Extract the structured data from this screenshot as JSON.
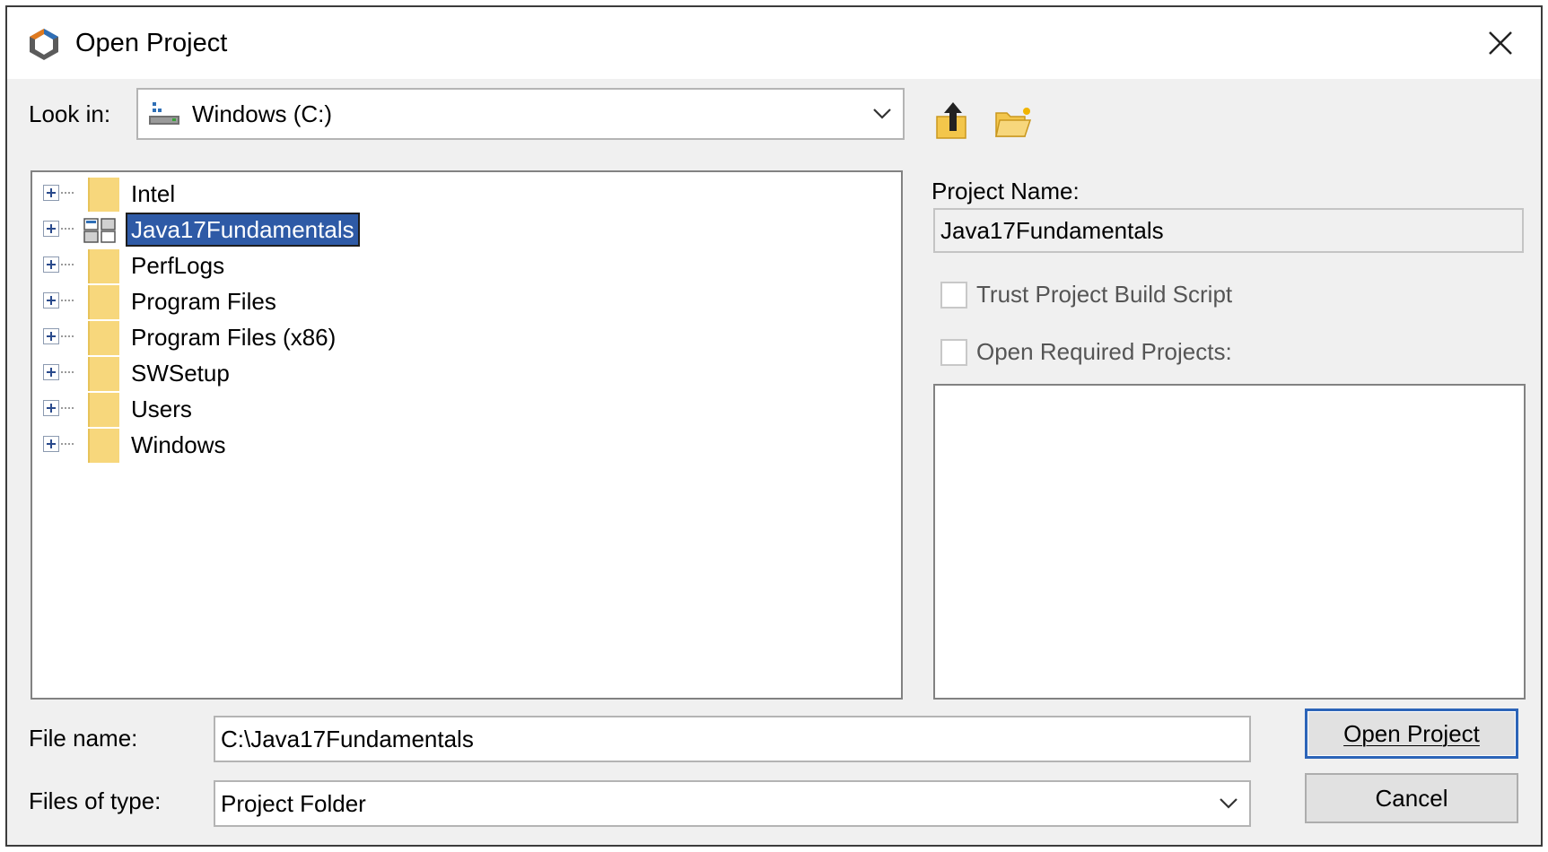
{
  "window": {
    "title": "Open Project",
    "app_icon": "netbeans-cube-icon",
    "close_icon": "close-icon"
  },
  "look_in": {
    "label": "Look in:",
    "value": "Windows (C:)",
    "drive_icon": "hard-drive-icon"
  },
  "toolbar": {
    "up_icon": "up-one-level-icon",
    "new_folder_icon": "new-folder-icon"
  },
  "tree": {
    "items": [
      {
        "label": "Intel",
        "icon": "folder-icon",
        "selected": false
      },
      {
        "label": "Java17Fundamentals",
        "icon": "project-icon",
        "selected": true
      },
      {
        "label": "PerfLogs",
        "icon": "folder-icon",
        "selected": false
      },
      {
        "label": "Program Files",
        "icon": "folder-icon",
        "selected": false
      },
      {
        "label": "Program Files (x86)",
        "icon": "folder-icon",
        "selected": false
      },
      {
        "label": "SWSetup",
        "icon": "folder-icon",
        "selected": false
      },
      {
        "label": "Users",
        "icon": "folder-icon",
        "selected": false
      },
      {
        "label": "Windows",
        "icon": "folder-icon",
        "selected": false
      }
    ]
  },
  "details": {
    "project_name_label": "Project Name:",
    "project_name_value": "Java17Fundamentals",
    "trust_label": "Trust Project Build Script",
    "trust_checked": false,
    "required_label": "Open Required Projects:",
    "required_checked": false
  },
  "bottom": {
    "file_name_label": "File name:",
    "file_name_value": "C:\\Java17Fundamentals",
    "files_of_type_label": "Files of type:",
    "files_of_type_value": "Project Folder"
  },
  "buttons": {
    "open": "Open Project",
    "cancel": "Cancel"
  },
  "colors": {
    "dialog_bg": "#f0f0f0",
    "selection_bg": "#2e5aa6",
    "folder_yellow": "#f7d77c",
    "default_button_border": "#2c64b8"
  }
}
